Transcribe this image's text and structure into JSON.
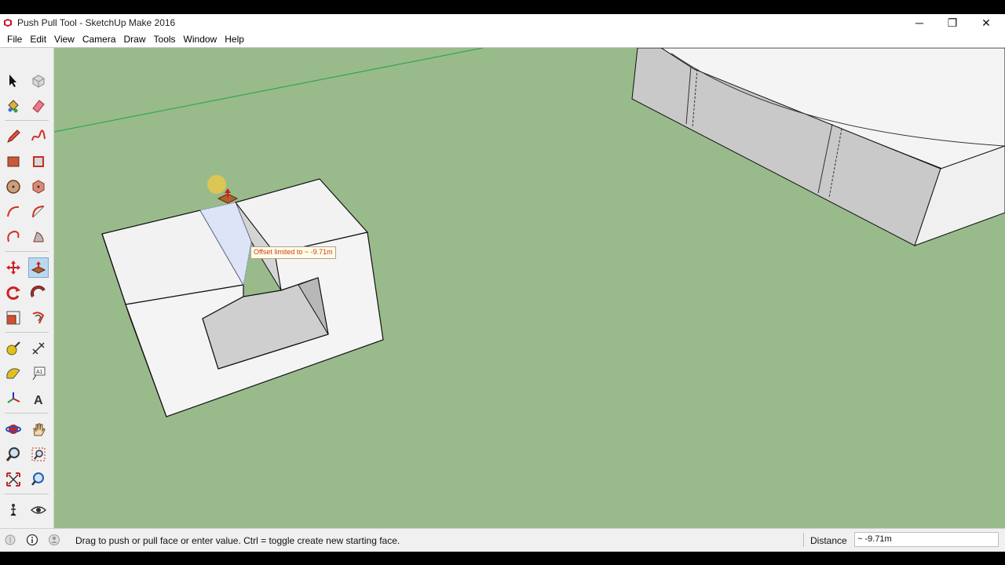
{
  "window": {
    "title": "Push Pull Tool - SketchUp Make 2016",
    "controls": {
      "minimize": "─",
      "restore": "❐",
      "close": "✕"
    }
  },
  "menu": [
    {
      "label": "File"
    },
    {
      "label": "Edit"
    },
    {
      "label": "View"
    },
    {
      "label": "Camera"
    },
    {
      "label": "Draw"
    },
    {
      "label": "Tools"
    },
    {
      "label": "Window"
    },
    {
      "label": "Help"
    }
  ],
  "toolbar": {
    "tools": [
      {
        "name": "select-tool",
        "icon": "arrow-icon"
      },
      {
        "name": "make-component-tool",
        "icon": "component-icon"
      },
      {
        "name": "paint-bucket-tool",
        "icon": "paint-bucket-icon"
      },
      {
        "name": "eraser-tool",
        "icon": "eraser-icon"
      },
      {
        "name": "line-tool",
        "icon": "pencil-icon"
      },
      {
        "name": "freehand-tool",
        "icon": "freehand-icon"
      },
      {
        "name": "rectangle-tool",
        "icon": "rectangle-icon"
      },
      {
        "name": "rotated-rectangle-tool",
        "icon": "rotated-rectangle-icon"
      },
      {
        "name": "circle-tool",
        "icon": "circle-icon"
      },
      {
        "name": "polygon-tool",
        "icon": "polygon-icon"
      },
      {
        "name": "arc-tool",
        "icon": "arc-icon"
      },
      {
        "name": "two-point-arc-tool",
        "icon": "two-point-arc-icon"
      },
      {
        "name": "three-point-arc-tool",
        "icon": "three-point-arc-icon"
      },
      {
        "name": "pie-tool",
        "icon": "pie-icon"
      },
      {
        "name": "move-tool",
        "icon": "move-icon"
      },
      {
        "name": "push-pull-tool",
        "icon": "push-pull-icon",
        "active": true
      },
      {
        "name": "rotate-tool",
        "icon": "rotate-icon"
      },
      {
        "name": "follow-me-tool",
        "icon": "follow-me-icon"
      },
      {
        "name": "scale-tool",
        "icon": "scale-icon"
      },
      {
        "name": "offset-tool",
        "icon": "offset-icon"
      },
      {
        "name": "tape-measure-tool",
        "icon": "tape-measure-icon"
      },
      {
        "name": "dimension-tool",
        "icon": "dimension-icon"
      },
      {
        "name": "protractor-tool",
        "icon": "protractor-icon"
      },
      {
        "name": "text-tool",
        "icon": "text-icon",
        "glyph": "A1"
      },
      {
        "name": "axes-tool",
        "icon": "axes-icon"
      },
      {
        "name": "3d-text-tool",
        "icon": "3d-text-icon",
        "glyph": "A"
      },
      {
        "name": "orbit-tool",
        "icon": "orbit-icon"
      },
      {
        "name": "pan-tool",
        "icon": "pan-hand-icon"
      },
      {
        "name": "zoom-tool",
        "icon": "zoom-icon"
      },
      {
        "name": "zoom-window-tool",
        "icon": "zoom-window-icon"
      },
      {
        "name": "zoom-extents-tool",
        "icon": "zoom-extents-icon"
      },
      {
        "name": "previous-view-tool",
        "icon": "previous-view-icon"
      },
      {
        "name": "position-camera-tool",
        "icon": "position-camera-icon"
      },
      {
        "name": "look-around-tool",
        "icon": "eye-icon"
      },
      {
        "name": "walk-tool",
        "icon": "footprints-icon"
      },
      {
        "name": "section-plane-tool",
        "icon": "section-plane-icon"
      }
    ]
  },
  "viewport": {
    "tooltip": "Offset limited to ~ -9.71m",
    "colors": {
      "ground": "#99bb8b",
      "face": "#f2f2f2",
      "shaded_face": "#c8c8c8",
      "green_axis": "#2fa84f",
      "cursor": "#e8c84a"
    }
  },
  "status": {
    "message": "Drag to push or pull face or enter value.  Ctrl = toggle create new starting face.",
    "vcb_label": "Distance",
    "vcb_value": "~ -9.71m"
  }
}
